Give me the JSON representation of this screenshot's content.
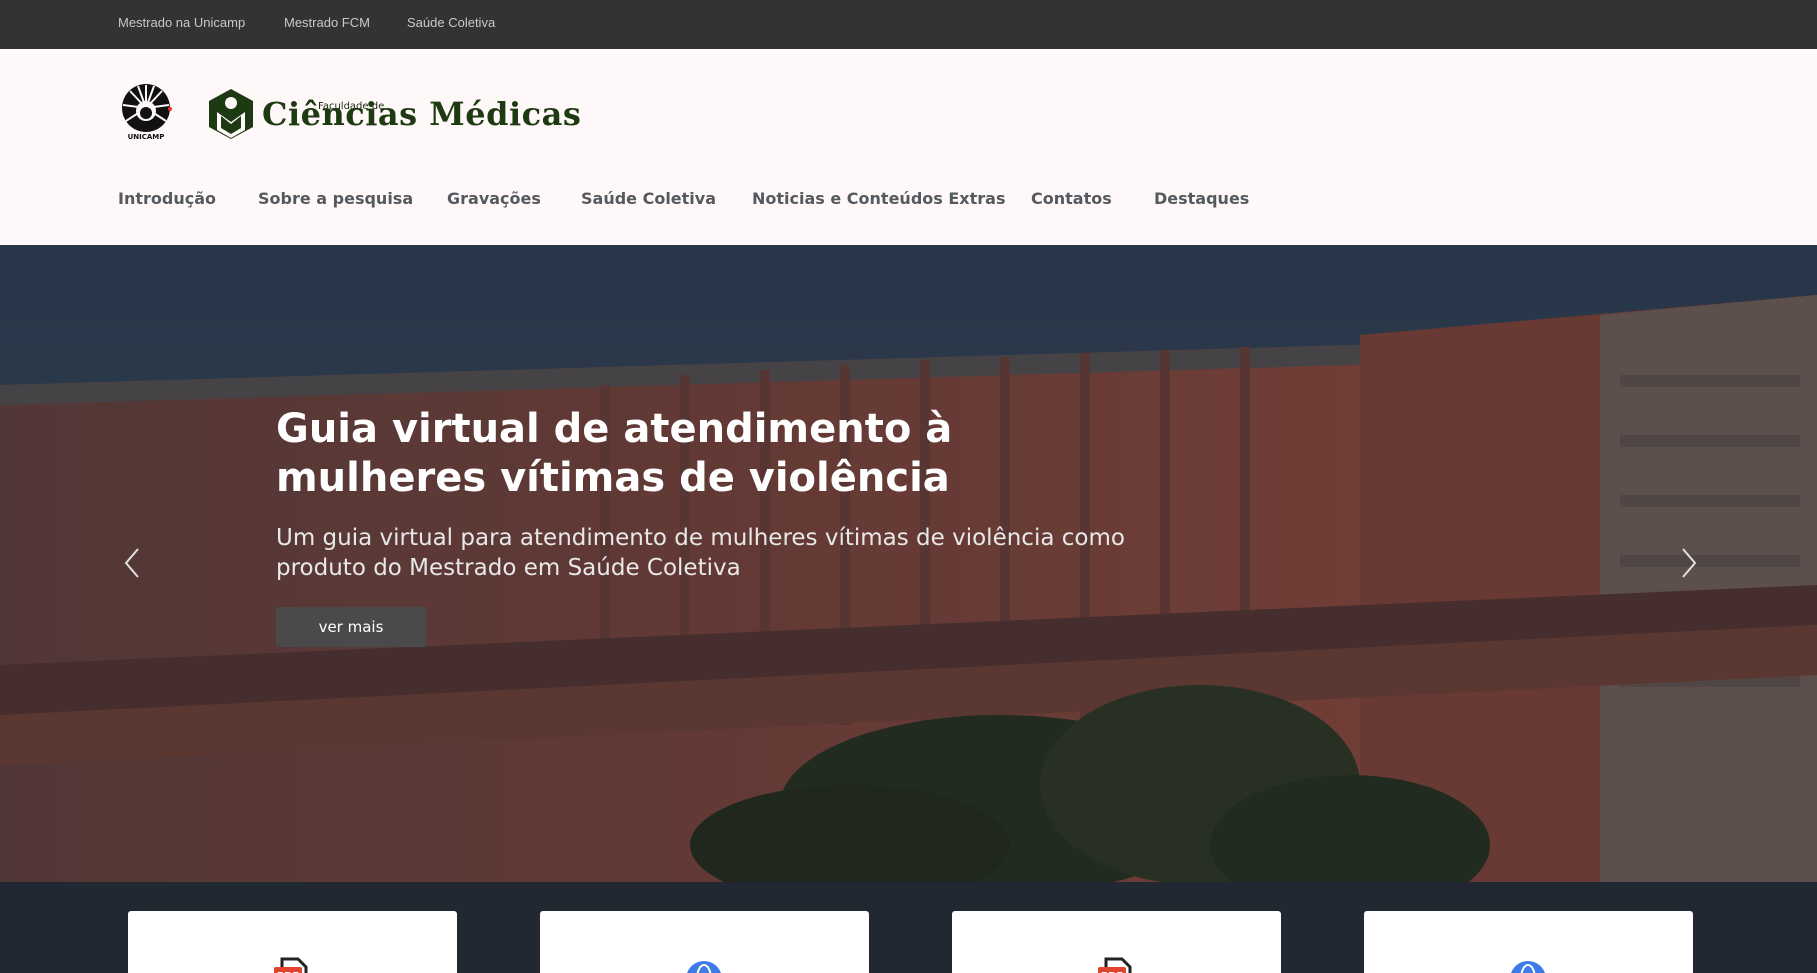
{
  "topbar": {
    "links": [
      "Mestrado na Unicamp",
      "Mestrado FCM",
      "Saúde Coletiva"
    ]
  },
  "header": {
    "unicamp_label": "UNICAMP",
    "fcm_small": "Faculdade de",
    "fcm_big": "Ciências Médicas"
  },
  "nav": {
    "items": [
      "Introdução",
      "Sobre a pesquisa",
      "Gravações",
      "Saúde Coletiva",
      "Noticias e Conteúdos Extras",
      "Contatos",
      "Destaques"
    ]
  },
  "hero": {
    "title": "Guia virtual de atendimento à mulheres vítimas de violência",
    "subtitle": "Um guia virtual para atendimento de mulheres vítimas de violência como produto do Mestrado em Saúde Coletiva",
    "button_label": "ver mais",
    "prev_icon": "chevron-left-icon",
    "next_icon": "chevron-right-icon"
  },
  "cards": [
    {
      "icon": "pdf-icon"
    },
    {
      "icon": "globe-icon"
    },
    {
      "icon": "pdf-icon"
    },
    {
      "icon": "globe-icon"
    }
  ],
  "colors": {
    "topbar_bg": "#333333",
    "header_bg": "#fff8f8",
    "footer_bg": "#222831",
    "brand_green": "#1e3a12",
    "pdf_red": "#e0442f",
    "globe_blue": "#3d7be8"
  }
}
